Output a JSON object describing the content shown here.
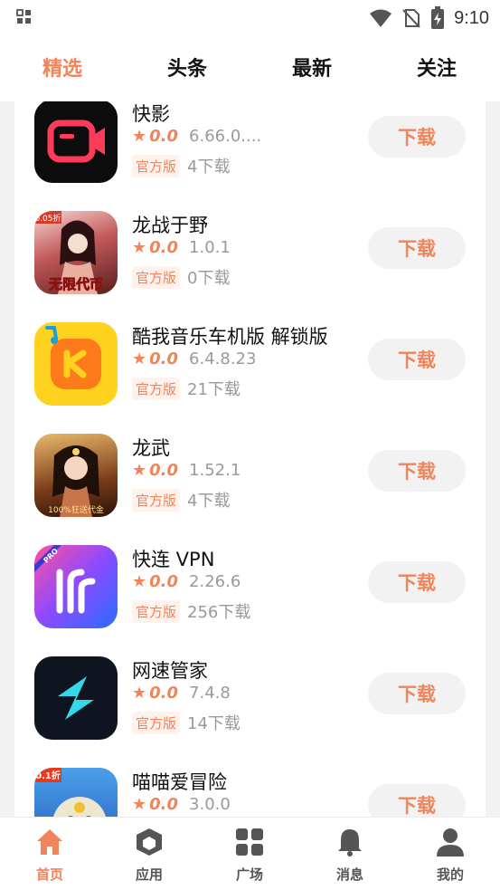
{
  "status_bar": {
    "time": "9:10"
  },
  "top_tabs": [
    {
      "label": "精选",
      "active": true
    },
    {
      "label": "头条",
      "active": false
    },
    {
      "label": "最新",
      "active": false
    },
    {
      "label": "关注",
      "active": false
    }
  ],
  "apps": [
    {
      "name": "快影",
      "rating": "0.0",
      "version": "6.66.0....",
      "badge": "官方版",
      "downloads": "4下载",
      "button": "下载",
      "icon": "kuaiying-app-icon"
    },
    {
      "name": "龙战于野",
      "rating": "0.0",
      "version": "1.0.1",
      "badge": "官方版",
      "downloads": "0下载",
      "button": "下载",
      "icon": "longzhanyuye-app-icon",
      "icon_text_top": "0.05折",
      "icon_text_bottom": "无限代币"
    },
    {
      "name": "酷我音乐车机版 解锁版",
      "rating": "0.0",
      "version": "6.4.8.23",
      "badge": "官方版",
      "downloads": "21下载",
      "button": "下载",
      "icon": "kuwo-music-app-icon"
    },
    {
      "name": "龙武",
      "rating": "0.0",
      "version": "1.52.1",
      "badge": "官方版",
      "downloads": "4下载",
      "button": "下载",
      "icon": "longwu-app-icon",
      "icon_text_bottom": "100%狂送代金"
    },
    {
      "name": "快连 VPN",
      "rating": "0.0",
      "version": "2.26.6",
      "badge": "官方版",
      "downloads": "256下载",
      "button": "下载",
      "icon": "kuailian-vpn-app-icon",
      "icon_text_top": "PRO"
    },
    {
      "name": "网速管家",
      "rating": "0.0",
      "version": "7.4.8",
      "badge": "官方版",
      "downloads": "14下载",
      "button": "下载",
      "icon": "wangsu-app-icon"
    },
    {
      "name": "喵喵爱冒险",
      "rating": "0.0",
      "version": "3.0.0",
      "badge": "",
      "downloads": "",
      "button": "下载",
      "icon": "miaomiao-app-icon",
      "icon_text_top": "0.1折"
    }
  ],
  "bottom_nav": [
    {
      "label": "首页",
      "icon": "home-icon",
      "active": true
    },
    {
      "label": "应用",
      "icon": "cube-icon",
      "active": false
    },
    {
      "label": "广场",
      "icon": "grid-icon",
      "active": false
    },
    {
      "label": "消息",
      "icon": "bell-icon",
      "active": false
    },
    {
      "label": "我的",
      "icon": "user-icon",
      "active": false
    }
  ],
  "colors": {
    "accent": "#f0845a",
    "text": "#111111",
    "muted": "#9a9a9a",
    "background": "#f2f2f2"
  }
}
